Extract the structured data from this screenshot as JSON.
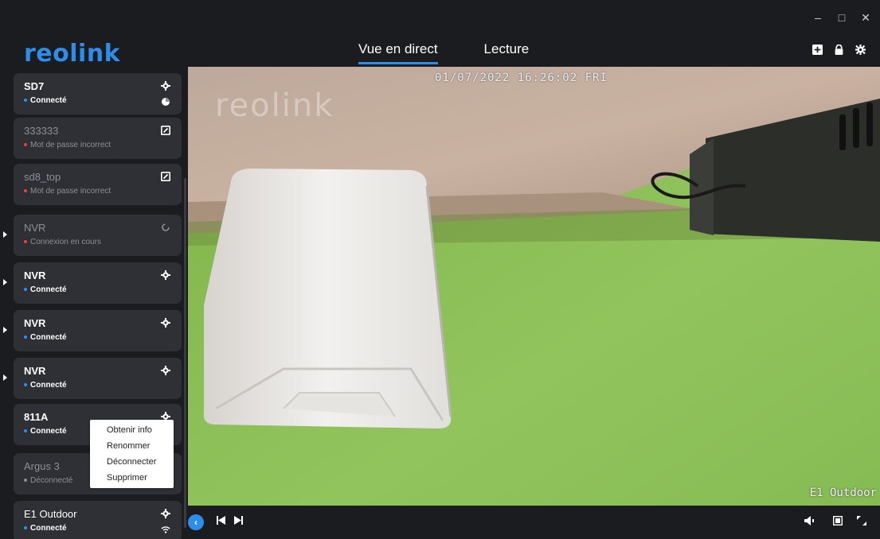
{
  "window": {
    "minimize": "–",
    "maximize": "□",
    "close": "✕"
  },
  "header": {
    "logo": "reolink",
    "tabs": [
      {
        "label": "Vue en direct",
        "active": true
      },
      {
        "label": "Lecture",
        "active": false
      }
    ],
    "icons": [
      "add-device-icon",
      "lock-icon",
      "settings-gear-icon"
    ]
  },
  "devices": [
    {
      "name": "SD7",
      "status": "Connecté",
      "state": "connected"
    },
    {
      "name": "333333",
      "status": "Mot de passe incorrect",
      "state": "error"
    },
    {
      "name": "sd8_top",
      "status": "Mot de passe incorrect",
      "state": "error"
    },
    {
      "name": "NVR",
      "status": "Connexion en cours",
      "state": "connecting"
    },
    {
      "name": "NVR",
      "status": "Connecté",
      "state": "connected"
    },
    {
      "name": "NVR",
      "status": "Connecté",
      "state": "connected"
    },
    {
      "name": "NVR",
      "status": "Connecté",
      "state": "connected"
    },
    {
      "name": "811A",
      "status": "Connecté",
      "state": "connected"
    },
    {
      "name": "Argus 3",
      "status": "Déconnecté",
      "state": "disconnected"
    },
    {
      "name": "E1 Outdoor",
      "status": "Connecté",
      "state": "connected"
    }
  ],
  "context_menu": [
    "Obtenir info",
    "Renommer",
    "Déconnecter",
    "Supprimer"
  ],
  "video": {
    "timestamp": "01/07/2022 16:26:02 FRI",
    "camera_label": "E1 Outdoor",
    "watermark": "reolink"
  },
  "colors": {
    "accent": "#2f8dea",
    "error": "#e6413e",
    "card": "#2e3036",
    "background": "#1b1c20"
  }
}
